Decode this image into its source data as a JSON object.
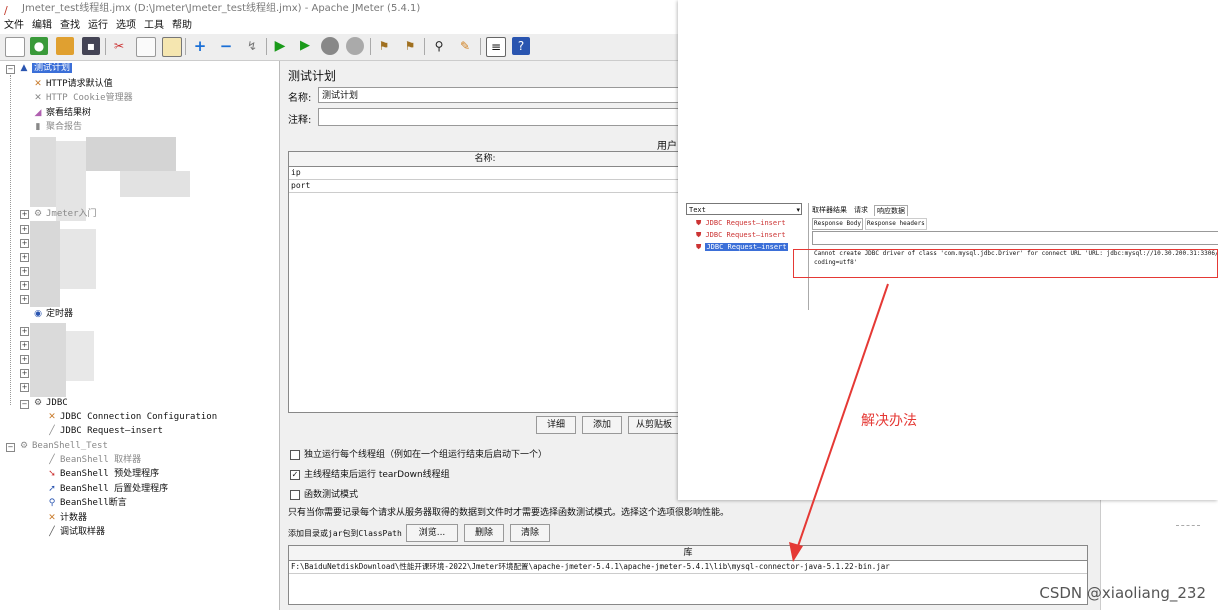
{
  "window": {
    "title": "Jmeter_test线程组.jmx (D:\\Jmeter\\Jmeter_test线程组.jmx) - Apache JMeter (5.4.1)"
  },
  "menu": [
    "文件",
    "编辑",
    "查找",
    "运行",
    "选项",
    "工具",
    "帮助"
  ],
  "tree": {
    "root": "测试计划",
    "items": {
      "http_defaults": "HTTP请求默认值",
      "cookie_manager": "HTTP Cookie管理器",
      "view_results": "察看结果树",
      "aggregate": "聚合报告",
      "jmeter_intro": "Jmeter入门",
      "timer": "定时器",
      "jdbc": "JDBC",
      "jdbc_config": "JDBC Connection Configuration",
      "jdbc_request": "JDBC Request—insert",
      "beanshell_test": "BeanShell_Test",
      "beanshell_sampler": "BeanShell 取样器",
      "beanshell_pre": "BeanShell 预处理程序",
      "beanshell_post": "BeanShell 后置处理程序",
      "beanshell_assert": "BeanShell断言",
      "counter": "计数器",
      "debug_sampler": "调试取样器"
    }
  },
  "panel": {
    "heading": "测试计划",
    "name_label": "名称:",
    "name_value": "测试计划",
    "comment_label": "注释:",
    "user_vars_label": "用户",
    "vars_table": {
      "header": "名称:",
      "rows": [
        "ip",
        "port"
      ]
    },
    "buttons": {
      "detail": "详细",
      "add": "添加",
      "paste": "从剪贴板"
    },
    "options": {
      "independent": "独立运行每个线程组（例如在一个组运行结束后启动下一个）",
      "teardown": "主线程结束后运行 tearDown线程组",
      "functional": "函数测试模式"
    },
    "functional_note": "只有当你需要记录每个请求从服务器取得的数据到文件时才需要选择函数测试模式。选择这个选项很影响性能。",
    "classpath_label": "添加目录或jar包到ClassPath",
    "classpath_buttons": {
      "browse": "浏览...",
      "delete": "删除",
      "clear": "清除"
    },
    "lib_table": {
      "header": "库",
      "rows": [
        "F:\\BaiduNetdiskDownload\\性能开课环境-2022\\Jmeter环境配置\\apache-jmeter-5.4.1\\apache-jmeter-5.4.1\\lib\\mysql-connector-java-5.1.22-bin.jar"
      ]
    }
  },
  "overlay": {
    "select_value": "Text",
    "results": [
      "JDBC Request—insert",
      "JDBC Request—insert",
      "JDBC Request—insert"
    ],
    "tabs": [
      "取样器结果",
      "请求",
      "响应数据"
    ],
    "subtabs": [
      "Response Body",
      "Response headers"
    ],
    "error_text_1": "Cannot create JDBC driver of class 'com.mysql.jdbc.Driver' for connect URL 'URL: jdbc:mysql://10.30.200.31:3306/",
    "error_text_2": "coding=utf8'",
    "annotation": "解决办法"
  },
  "watermark": "CSDN @xiaoliang_232",
  "colors": {
    "annotation_red": "#e53935",
    "selection_blue": "#3b6fd8"
  }
}
